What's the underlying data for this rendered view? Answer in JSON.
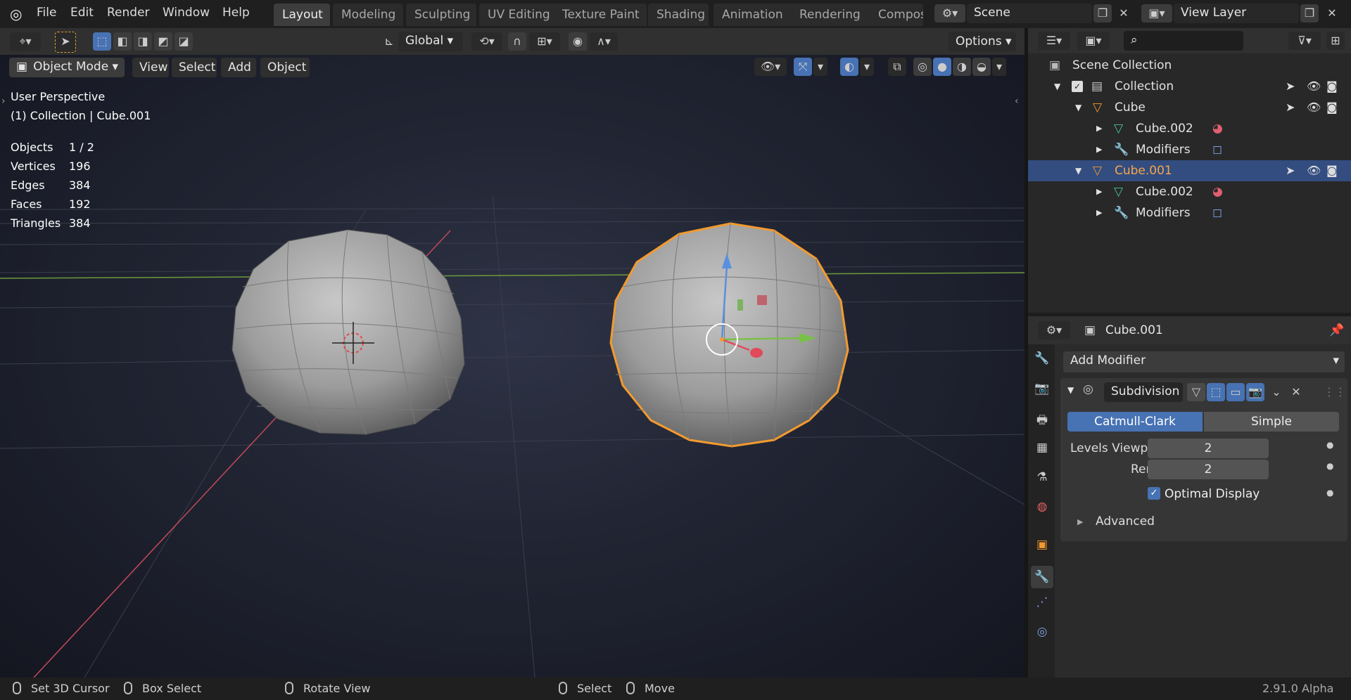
{
  "topbar": {
    "menus": [
      "File",
      "Edit",
      "Render",
      "Window",
      "Help"
    ],
    "tabs": [
      "Layout",
      "Modeling",
      "Sculpting",
      "UV Editing",
      "Texture Paint",
      "Shading",
      "Animation",
      "Rendering",
      "Compos"
    ],
    "active_tab": "Layout",
    "scene": "Scene",
    "view_layer": "View Layer"
  },
  "toolbar": {
    "transform_orientation": "Global",
    "options_label": "Options"
  },
  "viewport": {
    "mode": "Object Mode",
    "menus": [
      "View",
      "Select",
      "Add",
      "Object"
    ],
    "perspective": "User Perspective",
    "collection_info": "(1) Collection | Cube.001",
    "stats": [
      {
        "label": "Objects",
        "value": "1 / 2"
      },
      {
        "label": "Vertices",
        "value": "196"
      },
      {
        "label": "Edges",
        "value": "384"
      },
      {
        "label": "Faces",
        "value": "192"
      },
      {
        "label": "Triangles",
        "value": "384"
      }
    ]
  },
  "outliner": {
    "root": "Scene Collection",
    "collection": "Collection",
    "items": [
      {
        "name": "Cube",
        "children": [
          "Cube.002",
          "Modifiers"
        ]
      },
      {
        "name": "Cube.001",
        "selected": true,
        "children": [
          "Cube.002",
          "Modifiers"
        ]
      }
    ]
  },
  "properties": {
    "object_name": "Cube.001",
    "add_modifier": "Add Modifier",
    "modifier_name": "Subdivision",
    "algorithms": [
      "Catmull-Clark",
      "Simple"
    ],
    "active_algorithm": "Catmull-Clark",
    "levels_viewport_label": "Levels Viewport",
    "levels_viewport": "2",
    "render_label": "Render",
    "render_levels": "2",
    "optimal_display": "Optimal Display",
    "advanced": "Advanced"
  },
  "statusbar": {
    "items": [
      "Set 3D Cursor",
      "Box Select",
      "Rotate View",
      "Select",
      "Move"
    ],
    "version": "2.91.0 Alpha"
  },
  "colors": {
    "selection_outline": "#f29a30",
    "outliner_selected": "#334d80",
    "accent_blue": "#4772b3"
  }
}
